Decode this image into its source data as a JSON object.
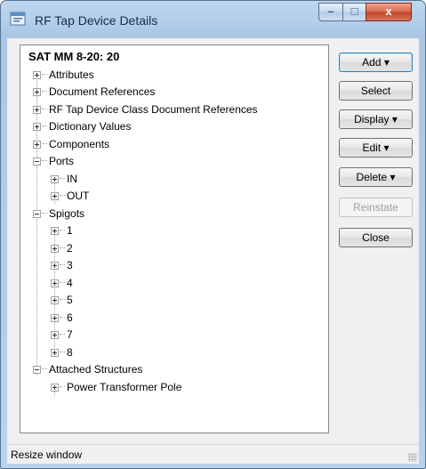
{
  "window": {
    "title": "RF Tap Device Details",
    "controls": {
      "minimize": "–",
      "maximize": "□",
      "close": "x"
    }
  },
  "tree": {
    "root": "SAT MM 8-20: 20",
    "top_nodes": [
      "Attributes",
      "Document References",
      "RF Tap Device Class Document References",
      "Dictionary Values",
      "Components"
    ],
    "ports": {
      "label": "Ports",
      "children": [
        "IN",
        "OUT"
      ]
    },
    "spigots": {
      "label": "Spigots",
      "children": [
        "1",
        "2",
        "3",
        "4",
        "5",
        "6",
        "7",
        "8"
      ]
    },
    "attached": {
      "label": "Attached Structures",
      "children": [
        "Power Transformer Pole"
      ]
    }
  },
  "buttons": {
    "add": "Add ▾",
    "select": "Select",
    "display": "Display ▾",
    "edit": "Edit ▾",
    "delete": "Delete ▾",
    "reinstate": "Reinstate",
    "close": "Close"
  },
  "status": {
    "text": "Resize window"
  },
  "colors": {
    "title_bar": "#a9c7e6",
    "close_button": "#c2472c",
    "tree_background": "#ffffff"
  }
}
